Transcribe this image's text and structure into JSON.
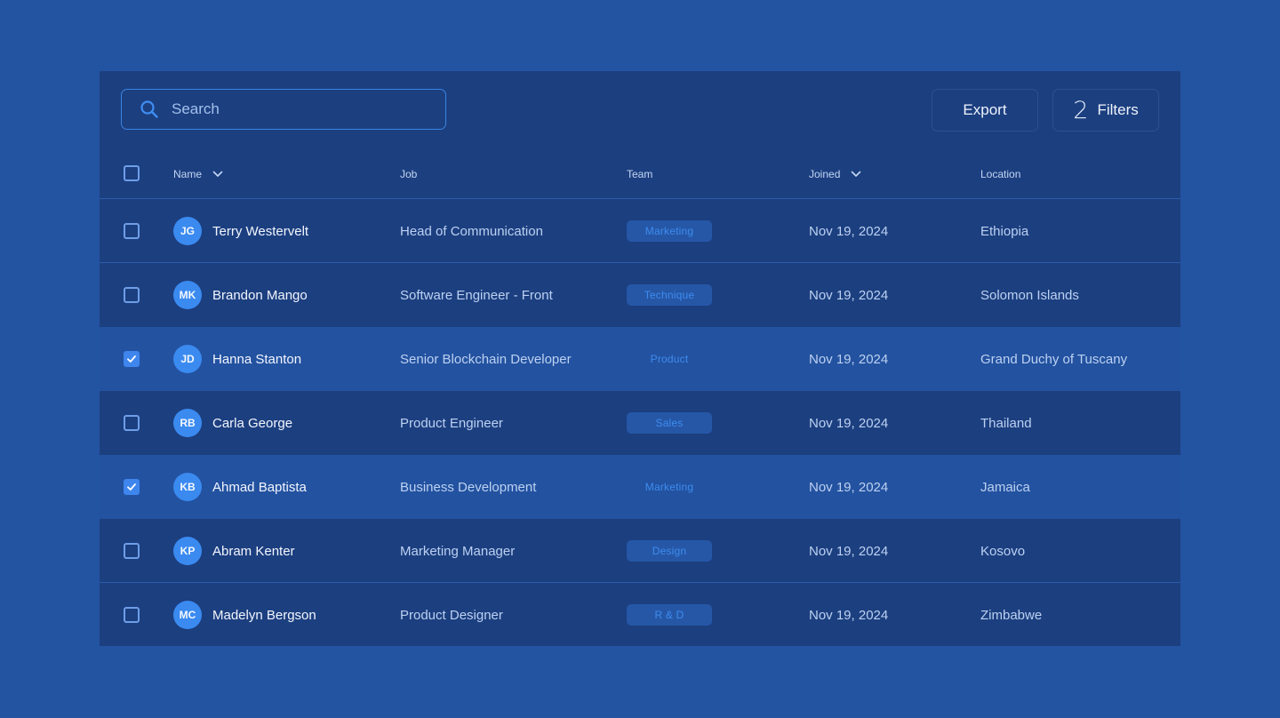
{
  "toolbar": {
    "search_placeholder": "Search",
    "export_label": "Export",
    "filters_count": "2",
    "filters_label": "Filters"
  },
  "columns": {
    "name": "Name",
    "job": "Job",
    "team": "Team",
    "joined": "Joined",
    "location": "Location"
  },
  "rows": [
    {
      "initials": "JG",
      "name": "Terry Westervelt",
      "job": "Head of Communication",
      "team": "Marketing",
      "joined": "Nov 19, 2024",
      "location": "Ethiopia",
      "checked": false
    },
    {
      "initials": "MK",
      "name": "Brandon Mango",
      "job": "Software Engineer - Front",
      "team": "Technique",
      "joined": "Nov 19, 2024",
      "location": "Solomon Islands",
      "checked": false
    },
    {
      "initials": "JD",
      "name": "Hanna Stanton",
      "job": "Senior Blockchain Developer",
      "team": "Product",
      "joined": "Nov 19, 2024",
      "location": "Grand Duchy of Tuscany",
      "checked": true
    },
    {
      "initials": "RB",
      "name": "Carla George",
      "job": "Product Engineer",
      "team": "Sales",
      "joined": "Nov 19, 2024",
      "location": "Thailand",
      "checked": false
    },
    {
      "initials": "KB",
      "name": "Ahmad Baptista",
      "job": "Business Development",
      "team": "Marketing",
      "joined": "Nov 19, 2024",
      "location": "Jamaica",
      "checked": true
    },
    {
      "initials": "KP",
      "name": "Abram Kenter",
      "job": "Marketing Manager",
      "team": "Design",
      "joined": "Nov 19, 2024",
      "location": "Kosovo",
      "checked": false
    },
    {
      "initials": "MC",
      "name": "Madelyn Bergson",
      "job": "Product Designer",
      "team": "R & D",
      "joined": "Nov 19, 2024",
      "location": "Zimbabwe",
      "checked": false
    }
  ],
  "colors": {
    "page_background": "#2354a2",
    "panel_background": "#1c3f80",
    "selected_row": "#2352a0",
    "accent": "#3e86ee",
    "team_tag_text": "#3d8cf0"
  },
  "icons": {
    "search": "search-icon",
    "sort": "chevron-down-icon",
    "check": "check-icon"
  }
}
